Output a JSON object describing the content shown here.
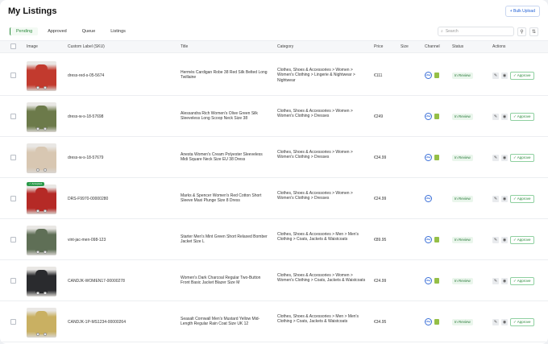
{
  "header": {
    "title": "My Listings",
    "bulk_upload": "+ Bulk Upload"
  },
  "tabs": [
    {
      "label": "Pending",
      "active": true
    },
    {
      "label": "Approved",
      "active": false
    },
    {
      "label": "Queue",
      "active": false
    },
    {
      "label": "Listings",
      "active": false
    }
  ],
  "search": {
    "placeholder": "Search"
  },
  "columns": {
    "image": "Image",
    "sku": "Custom Label (SKU)",
    "title": "Title",
    "category": "Category",
    "price": "Price",
    "size": "Size",
    "channel": "Channel",
    "status": "Status",
    "actions": "Actions"
  },
  "rows": [
    {
      "sku": "dress-red-s-05-5674",
      "title": "Hermès Cardigan Robe 38 Red Silk Belted Long Twillaine",
      "category": "Clothes, Shoes & Accessories > Women > Women's Clothing > Lingerie & Nightwear > Nightwear",
      "price": "€111",
      "status": "In Review",
      "approve": "✓ Approve",
      "badge": "",
      "thumb_color": "#c23a2e"
    },
    {
      "sku": "dress-w-s-18-57698",
      "title": "Alessandra Rich Women's Olive Green Silk Sleeveless Long Scoop Neck Size 38",
      "category": "Clothes, Shoes & Accessories > Women > Women's Clothing > Dresses",
      "price": "€249",
      "status": "In Review",
      "approve": "✓ Approve",
      "badge": "",
      "thumb_color": "#6c7a4a"
    },
    {
      "sku": "dress-w-s-18-57679",
      "title": "Anesta Women's Cream Polyester Sleeveless Midi Square Neck Size EU 38 Dress",
      "category": "Clothes, Shoes & Accessories > Women > Women's Clothing > Dresses",
      "price": "€34.99",
      "status": "In Review",
      "approve": "✓ Approve",
      "badge": "",
      "thumb_color": "#d8c7b2"
    },
    {
      "sku": "DRS-F9970-00000280",
      "title": "Marks & Spencer Women's Red Cotton Short Sleeve Maxi Plunge Size 8 Dress",
      "category": "Clothes, Shoes & Accessories > Women > Women's Clothing > Dresses",
      "price": "€24.99",
      "status": "In Review",
      "approve": "✓ Approve",
      "badge": "✓ Accepted",
      "thumb_color": "#b52a26"
    },
    {
      "sku": "vint-jac-men-098-123",
      "title": "Starter Men's Mint Green Short Relaxed Bomber Jacket Size L",
      "category": "Clothes, Shoes & Accessories > Men > Men's Clothing > Coats, Jackets & Waistcoats",
      "price": "€89.95",
      "status": "In Review",
      "approve": "✓ Approve",
      "badge": "",
      "thumb_color": "#5f6f56"
    },
    {
      "sku": "CANDJK-WOMEN17-00000278",
      "title": "Women's Dark Charcoal Regular Two-Button Front Basic Jacket Blazer Size M",
      "category": "Clothes, Shoes & Accessories > Women > Women's Clothing > Coats, Jackets & Waistcoats",
      "price": "€24.99",
      "status": "In Review",
      "approve": "✓ Approve",
      "badge": "",
      "thumb_color": "#2a2b2e"
    },
    {
      "sku": "CANDJK-1P-MS1234-00000264",
      "title": "Seasalt Cornwall Men's Mustard Yellow Mid-Length Regular Rain Coat Size UK 12",
      "category": "Clothes, Shoes & Accessories > Men > Men's Clothing > Coats, Jackets & Waistcoats",
      "price": "€34.95",
      "status": "In Review",
      "approve": "✓ Approve",
      "badge": "",
      "thumb_color": "#c9b062"
    }
  ],
  "channel": {
    "circle_label": "eBay"
  }
}
